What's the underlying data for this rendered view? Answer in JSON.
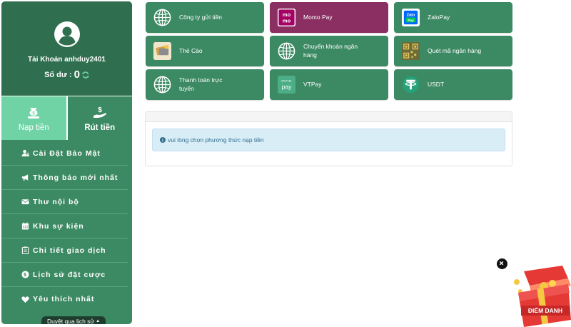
{
  "account": {
    "label": "Tài Khoản anhduy2401",
    "balance_label": "Số dư :",
    "balance_value": "0"
  },
  "actions": [
    {
      "label": "Nạp tiền",
      "active": true
    },
    {
      "label": "Rút tiền",
      "active": false
    }
  ],
  "menu": [
    {
      "label": "Cài Đặt Bảo Mật",
      "icon": "user-lock-icon"
    },
    {
      "label": "Thông báo mới nhất",
      "icon": "megaphone-icon"
    },
    {
      "label": "Thư nội bộ",
      "icon": "envelope-icon"
    },
    {
      "label": "Khu sự kiện",
      "icon": "calendar-icon"
    },
    {
      "label": "Chi tiết giao dịch",
      "icon": "clipboard-icon"
    },
    {
      "label": "Lịch sử đặt cược",
      "icon": "dollar-circle-icon"
    },
    {
      "label": "Yêu thích nhất",
      "icon": "heart-icon"
    }
  ],
  "history_tab": {
    "label": "Duyệt qua lịch sử"
  },
  "payments": [
    {
      "label": "Công ty gửi tiền",
      "icon": "globe-icon"
    },
    {
      "label": "Momo Pay",
      "icon": "momo-icon"
    },
    {
      "label": "ZaloPay",
      "icon": "zalopay-icon"
    },
    {
      "label": "Thẻ Cào",
      "icon": "scratch-card-icon"
    },
    {
      "label": "Chuyển khoản ngân hàng",
      "icon": "globe-icon"
    },
    {
      "label": "Quét mã ngân hàng",
      "icon": "qr-code-icon"
    },
    {
      "label": "Thanh toán trực tuyến",
      "icon": "globe-icon"
    },
    {
      "label": "VTPay",
      "icon": "vtpay-icon"
    },
    {
      "label": "USDT",
      "icon": "tether-icon"
    }
  ],
  "notice": {
    "text": "vui lòng chọn phương thức nạp tiền"
  },
  "checkin": {
    "label": "ĐIỂM DANH"
  },
  "colors": {
    "primary": "#3c8a63",
    "dark": "#2f6f4f",
    "active": "#6fd3a5",
    "momo": "#8b2f63",
    "alert_bg": "#d9edf7",
    "alert_text": "#31708f"
  }
}
